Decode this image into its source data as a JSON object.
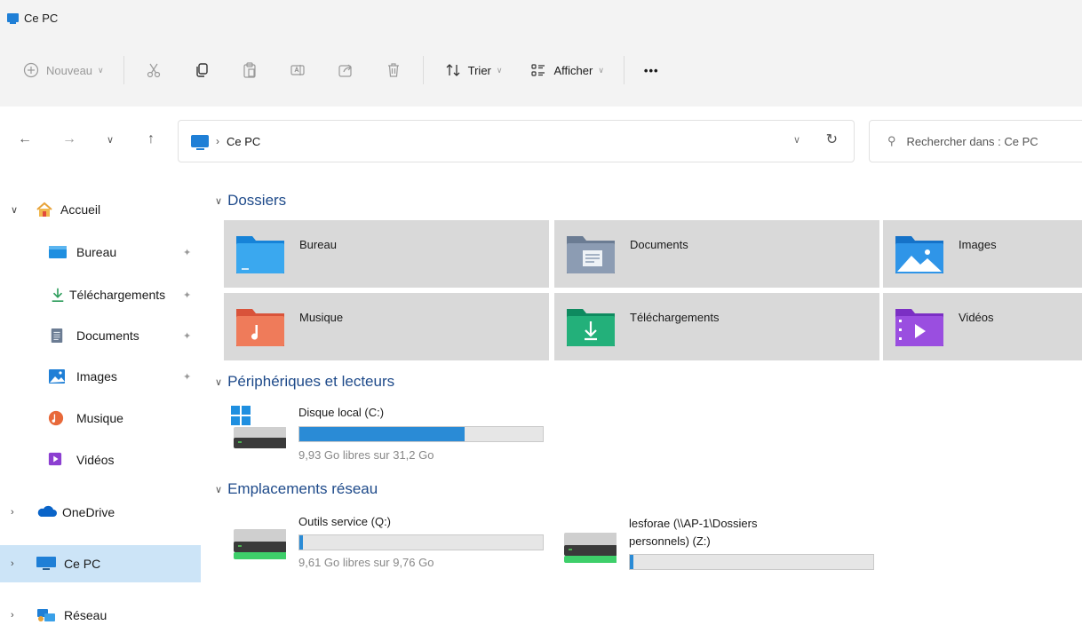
{
  "window": {
    "title": "Ce PC"
  },
  "toolbar": {
    "new_label": "Nouveau",
    "sort_label": "Trier",
    "view_label": "Afficher",
    "more_label": "•••"
  },
  "address": {
    "crumb": "Ce PC",
    "search_placeholder": "Rechercher dans : Ce PC"
  },
  "sidebar": {
    "items": [
      {
        "label": "Accueil",
        "icon": "home-icon",
        "expanded": true
      },
      {
        "label": "Bureau",
        "icon": "desktop-folder-icon",
        "pinned": true
      },
      {
        "label": "Téléchargements",
        "icon": "download-icon",
        "pinned": true
      },
      {
        "label": "Documents",
        "icon": "documents-icon",
        "pinned": true
      },
      {
        "label": "Images",
        "icon": "images-icon",
        "pinned": true
      },
      {
        "label": "Musique",
        "icon": "music-icon"
      },
      {
        "label": "Vidéos",
        "icon": "videos-icon"
      },
      {
        "label": "OneDrive",
        "icon": "cloud-icon"
      },
      {
        "label": "Ce PC",
        "icon": "pc-icon",
        "selected": true
      },
      {
        "label": "Réseau",
        "icon": "network-icon"
      }
    ]
  },
  "sections": {
    "folders_title": "Dossiers",
    "drives_title": "Périphériques et lecteurs",
    "network_title": "Emplacements réseau"
  },
  "folders": [
    {
      "label": "Bureau",
      "icon": "desktop-folder-icon"
    },
    {
      "label": "Documents",
      "icon": "documents-folder-icon"
    },
    {
      "label": "Images",
      "icon": "images-folder-icon"
    },
    {
      "label": "Musique",
      "icon": "music-folder-icon"
    },
    {
      "label": "Téléchargements",
      "icon": "downloads-folder-icon"
    },
    {
      "label": "Vidéos",
      "icon": "videos-folder-icon"
    }
  ],
  "drives": [
    {
      "name": "Disque local (C:)",
      "free": "9,93 Go libres sur 31,2 Go",
      "used_fraction": 0.68
    }
  ],
  "network": [
    {
      "name": "Outils service (Q:)",
      "free": "9,61 Go libres sur 9,76 Go",
      "used_fraction": 0.015
    },
    {
      "name": "lesforae (\\\\AP-1\\Dossiers personnels) (Z:)",
      "name_line1": "lesforae (\\\\AP-1\\Dossiers",
      "name_line2": "personnels) (Z:)",
      "free": "",
      "used_fraction": 0.015
    }
  ],
  "colors": {
    "accent": "#2a8bd6",
    "selected_bg": "#cce4f7",
    "section_title": "#1e4a8a"
  }
}
